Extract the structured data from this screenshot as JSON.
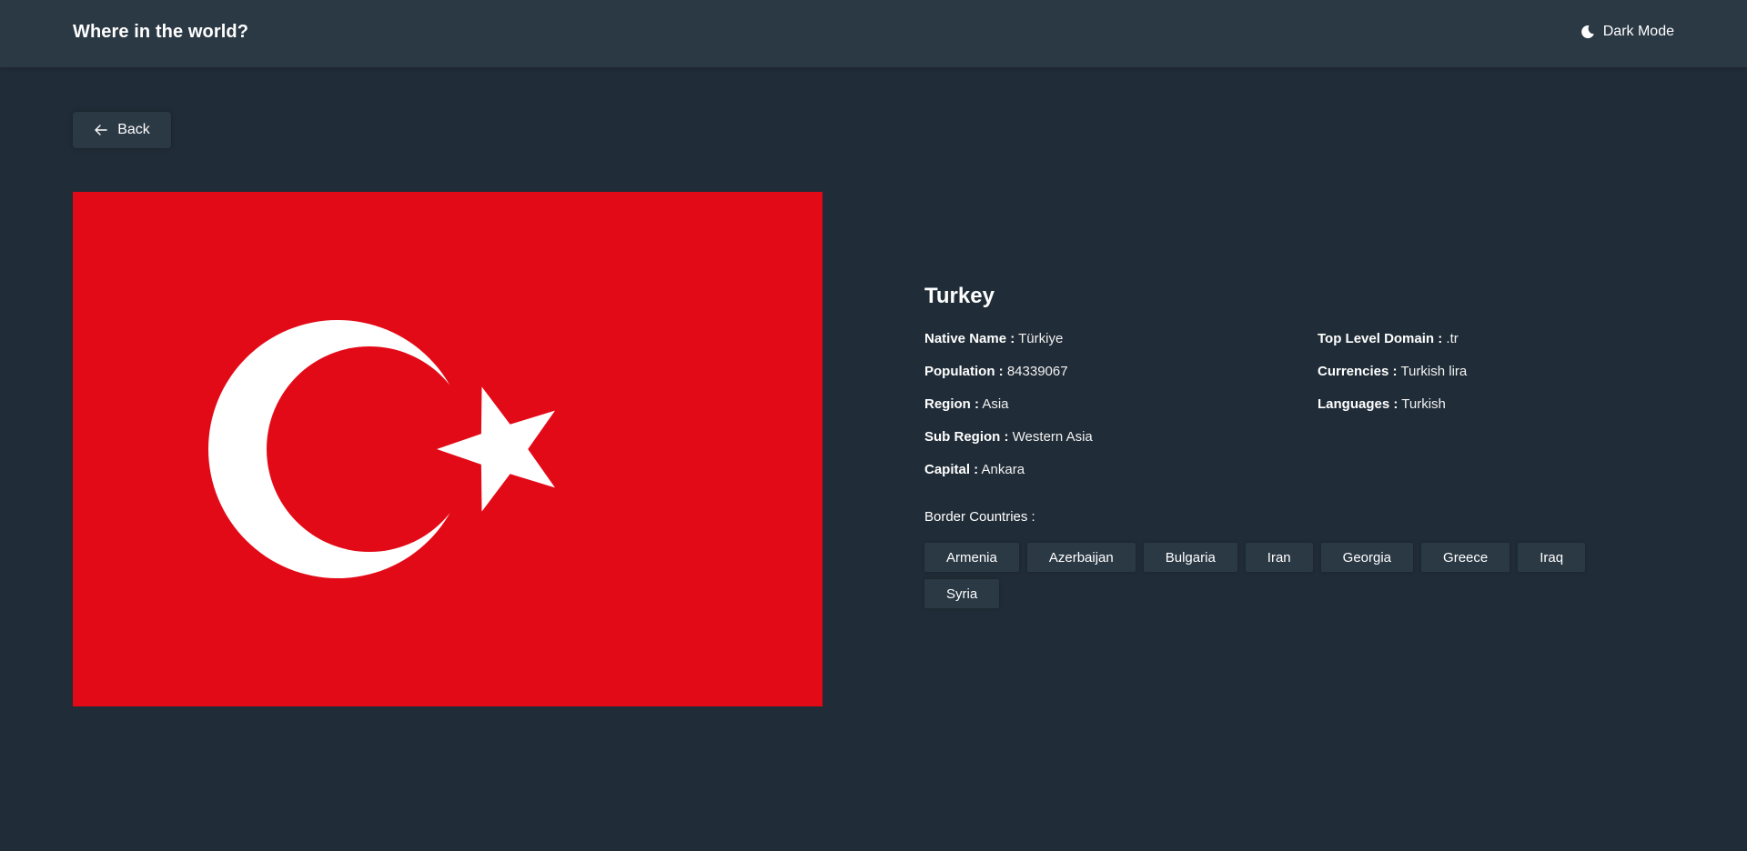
{
  "header": {
    "title": "Where in the world?",
    "theme_toggle_label": "Dark Mode",
    "theme_icon": "moon-icon"
  },
  "back_button": {
    "label": "Back",
    "icon": "arrow-left-icon"
  },
  "flag": {
    "icon": "turkey-flag",
    "colors": {
      "background": "#e30a17",
      "emblem": "#ffffff"
    }
  },
  "country": {
    "name": "Turkey",
    "native_name_label": "Native Name :",
    "native_name": "Türkiye",
    "population_label": "Population :",
    "population": "84339067",
    "region_label": "Region :",
    "region": "Asia",
    "sub_region_label": "Sub Region :",
    "sub_region": "Western Asia",
    "capital_label": "Capital :",
    "capital": "Ankara",
    "tld_label": "Top Level Domain :",
    "tld": ".tr",
    "currencies_label": "Currencies :",
    "currencies": "Turkish lira",
    "languages_label": "Languages :",
    "languages": "Turkish"
  },
  "borders": {
    "label": "Border Countries :",
    "items": [
      "Armenia",
      "Azerbaijan",
      "Bulgaria",
      "Iran",
      "Georgia",
      "Greece",
      "Iraq",
      "Syria"
    ]
  },
  "colors": {
    "background": "#202c37",
    "element": "#2b3945",
    "text": "#ffffff"
  }
}
